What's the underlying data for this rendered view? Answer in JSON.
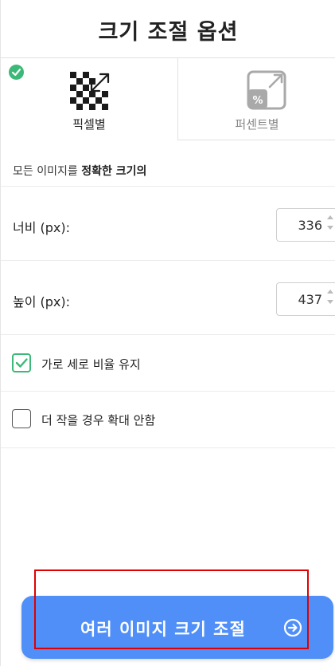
{
  "panel": {
    "title": "크기 조절 옵션"
  },
  "tabs": [
    {
      "label": "픽셀별",
      "icon": "pixel-resize-icon",
      "selected": true
    },
    {
      "label": "퍼센트별",
      "icon": "percent-resize-icon",
      "selected": false
    }
  ],
  "description": {
    "prefix": "모든 이미지를 ",
    "bold": "정확한 크기의"
  },
  "width": {
    "label": "너비 (px):",
    "value": "336"
  },
  "height": {
    "label": "높이 (px):",
    "value": "437"
  },
  "options": [
    {
      "label": "가로 세로 비율 유지",
      "checked": true
    },
    {
      "label": "더 작을 경우 확대 안함",
      "checked": false
    }
  ],
  "cta": {
    "label": "여러 이미지 크기 조절",
    "icon": "arrow-circle-right-icon"
  },
  "colors": {
    "accent": "#4f8ff7",
    "success": "#3cb878",
    "highlight": "#e00000"
  }
}
